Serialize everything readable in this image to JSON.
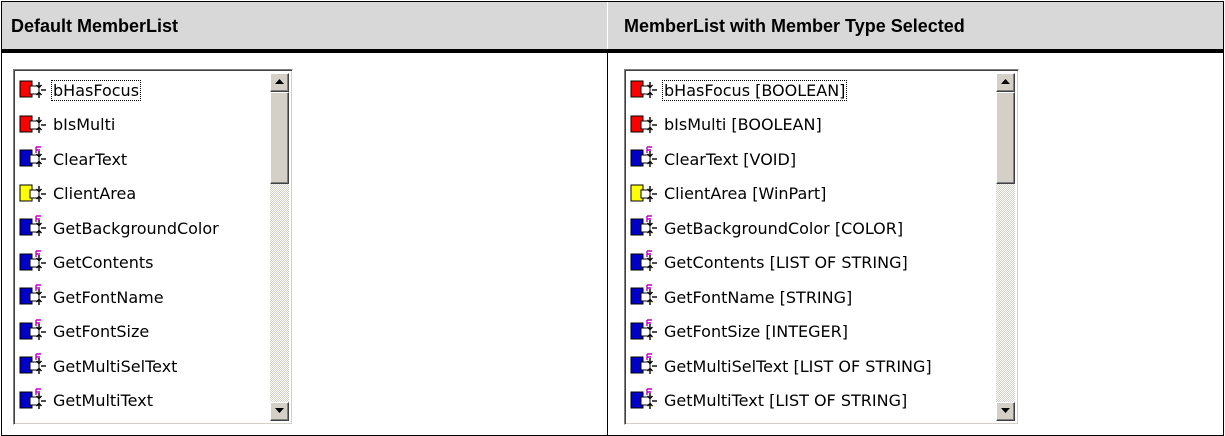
{
  "header": {
    "left_title": "Default MemberList",
    "right_title": "MemberList with Member Type Selected"
  },
  "left_list": {
    "items": [
      {
        "label": "bHasFocus",
        "icon": "red-property-icon"
      },
      {
        "label": "bIsMulti",
        "icon": "red-property-icon"
      },
      {
        "label": "ClearText",
        "icon": "blue-method-icon"
      },
      {
        "label": "ClientArea",
        "icon": "yellow-property-icon"
      },
      {
        "label": "GetBackgroundColor",
        "icon": "blue-method-icon"
      },
      {
        "label": "GetContents",
        "icon": "blue-method-icon"
      },
      {
        "label": "GetFontName",
        "icon": "blue-method-icon"
      },
      {
        "label": "GetFontSize",
        "icon": "blue-method-icon"
      },
      {
        "label": "GetMultiSelText",
        "icon": "blue-method-icon"
      },
      {
        "label": "GetMultiText",
        "icon": "blue-method-icon"
      }
    ]
  },
  "right_list": {
    "items": [
      {
        "label": "bHasFocus [BOOLEAN]",
        "icon": "red-property-icon"
      },
      {
        "label": "bIsMulti [BOOLEAN]",
        "icon": "red-property-icon"
      },
      {
        "label": "ClearText [VOID]",
        "icon": "blue-method-icon"
      },
      {
        "label": "ClientArea [WinPart]",
        "icon": "yellow-property-icon"
      },
      {
        "label": "GetBackgroundColor [COLOR]",
        "icon": "blue-method-icon"
      },
      {
        "label": "GetContents [LIST OF STRING]",
        "icon": "blue-method-icon"
      },
      {
        "label": "GetFontName [STRING]",
        "icon": "blue-method-icon"
      },
      {
        "label": "GetFontSize [INTEGER]",
        "icon": "blue-method-icon"
      },
      {
        "label": "GetMultiSelText [LIST OF STRING]",
        "icon": "blue-method-icon"
      },
      {
        "label": "GetMultiText [LIST OF STRING]",
        "icon": "blue-method-icon"
      }
    ]
  },
  "colors": {
    "property_red": "#ff0000",
    "method_blue": "#0000c8",
    "winpart_yellow": "#ffff00",
    "header_bg": "#d8d8d8"
  }
}
